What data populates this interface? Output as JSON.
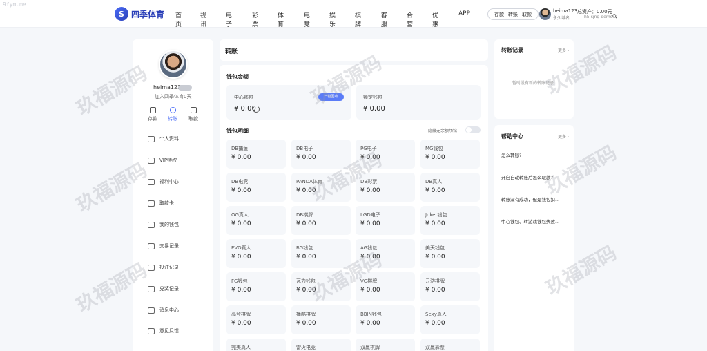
{
  "corner_watermark": "9fym.me",
  "brand": {
    "mark": "S",
    "name": "四季体育"
  },
  "nav": [
    "首页",
    "视讯",
    "电子",
    "彩票",
    "体育",
    "电竞",
    "娱乐",
    "棋牌",
    "客服",
    "合营",
    "优惠",
    "APP"
  ],
  "header_actions": [
    "存款",
    "转账",
    "取款"
  ],
  "user": {
    "name": "heima123",
    "assets_label": "总资产：",
    "assets_value": "0.00元",
    "domain_label": "永久域名：",
    "domain_value": "h5-sjng-demo..."
  },
  "profile": {
    "username": "heima123",
    "joined": "加入四季体育0天"
  },
  "quick_actions": [
    "存款",
    "转账",
    "取款"
  ],
  "menu": [
    "个人资料",
    "VIP特权",
    "福利中心",
    "取款卡",
    "我的钱包",
    "交易记录",
    "投注记录",
    "兑奖记录",
    "消息中心",
    "意见反馈"
  ],
  "page_title": "转账",
  "wallet_balance": {
    "title": "钱包金额",
    "center_label": "中心钱包",
    "center_value": "¥ 0.00",
    "recycle_button": "一键回收",
    "locked_label": "锁定钱包",
    "locked_value": "¥ 0.00"
  },
  "wallet_detail": {
    "title": "钱包明细",
    "hide_label": "隐藏无余额场馆"
  },
  "wallets": [
    {
      "name": "DB捕鱼",
      "value": "¥ 0.00"
    },
    {
      "name": "DB电子",
      "value": "¥ 0.00"
    },
    {
      "name": "PG电子",
      "value": "¥ 0.00"
    },
    {
      "name": "MG钱包",
      "value": "¥ 0.00"
    },
    {
      "name": "DB电竞",
      "value": "¥ 0.00"
    },
    {
      "name": "PANDA体育",
      "value": "¥ 0.00"
    },
    {
      "name": "DB彩票",
      "value": "¥ 0.00"
    },
    {
      "name": "DB真人",
      "value": "¥ 0.00"
    },
    {
      "name": "OG真人",
      "value": "¥ 0.00"
    },
    {
      "name": "DB棋牌",
      "value": "¥ 0.00"
    },
    {
      "name": "LGD电子",
      "value": "¥ 0.00"
    },
    {
      "name": "Joker钱包",
      "value": "¥ 0.00"
    },
    {
      "name": "EVO真人",
      "value": "¥ 0.00"
    },
    {
      "name": "BG钱包",
      "value": "¥ 0.00"
    },
    {
      "name": "AG钱包",
      "value": "¥ 0.00"
    },
    {
      "name": "美天钱包",
      "value": "¥ 0.00"
    },
    {
      "name": "FG钱包",
      "value": "¥ 0.00"
    },
    {
      "name": "瓦力钱包",
      "value": "¥ 0.00"
    },
    {
      "name": "VG棋牌",
      "value": "¥ 0.00"
    },
    {
      "name": "云游棋牌",
      "value": "¥ 0.00"
    },
    {
      "name": "高登棋牌",
      "value": "¥ 0.00"
    },
    {
      "name": "播酷棋牌",
      "value": "¥ 0.00"
    },
    {
      "name": "BBIN钱包",
      "value": "¥ 0.00"
    },
    {
      "name": "Sexy真人",
      "value": "¥ 0.00"
    },
    {
      "name": "完美真人",
      "value": ""
    },
    {
      "name": "雷火电竞",
      "value": ""
    },
    {
      "name": "双赢棋牌",
      "value": ""
    },
    {
      "name": "双赢彩票",
      "value": ""
    }
  ],
  "transfer_records": {
    "title": "转账记录",
    "more": "更多 ›",
    "empty": "暂时没有新的转账记录"
  },
  "help_center": {
    "title": "帮助中心",
    "more": "更多 ›",
    "items": [
      "怎么转账?",
      "开启自动转账后怎么取款?",
      "转账没有成功，但是钱包扣...",
      "中心钱包、转游戏钱包失败..."
    ]
  },
  "watermark_text": "玖福源码"
}
